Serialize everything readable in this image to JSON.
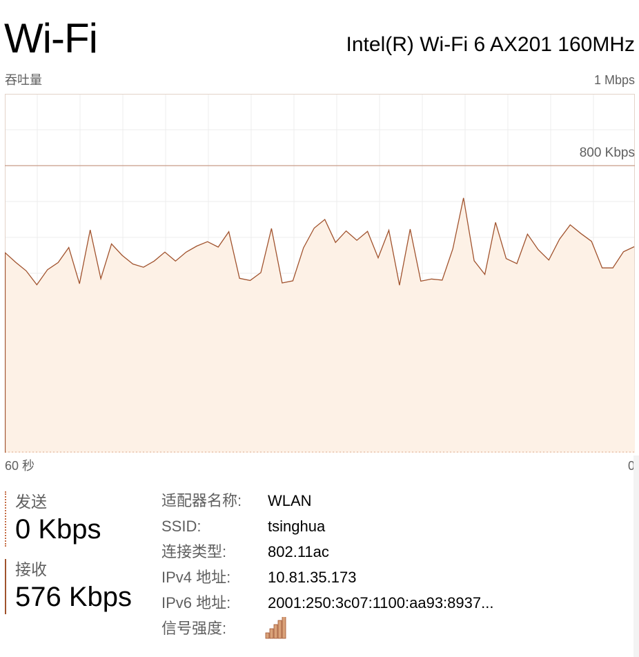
{
  "header": {
    "title": "Wi-Fi",
    "adapter_name": "Intel(R) Wi-Fi 6 AX201 160MHz"
  },
  "graph": {
    "throughput_label": "吞吐量",
    "max_label": "1 Mbps",
    "reference_label": "800 Kbps",
    "time_left_label": "60 秒",
    "time_right_label": "0",
    "colors": {
      "line": "#a0522d",
      "fill": "#fdf1e6",
      "grid": "#ececec",
      "reference_line": "#c89b87",
      "border": "#e3d3c9",
      "dashed_send": "#c46a42"
    }
  },
  "chart_data": {
    "type": "area",
    "title": "吞吐量",
    "ylim": [
      0,
      1000
    ],
    "reference_kbps": 800,
    "series": [
      {
        "name": "接收",
        "values": [
          558,
          531,
          507,
          468,
          510,
          530,
          572,
          471,
          621,
          485,
          582,
          550,
          526,
          517,
          534,
          559,
          534,
          559,
          576,
          588,
          573,
          616,
          486,
          480,
          502,
          625,
          473,
          479,
          571,
          626,
          650,
          586,
          618,
          592,
          617,
          543,
          620,
          467,
          623,
          478,
          484,
          481,
          568,
          710,
          535,
          497,
          642,
          541,
          527,
          609,
          566,
          537,
          595,
          635,
          611,
          589,
          515,
          515,
          560,
          574
        ]
      },
      {
        "name": "发送",
        "values": [
          0,
          0,
          0,
          0,
          0,
          0,
          0,
          0,
          0,
          0,
          0,
          0,
          0,
          0,
          0,
          0,
          0,
          0,
          0,
          0,
          0,
          0,
          0,
          0,
          0,
          0,
          0,
          0,
          0,
          0,
          0,
          0,
          0,
          0,
          0,
          0,
          0,
          0,
          0,
          0,
          0,
          0,
          0,
          0,
          0,
          0,
          0,
          0,
          0,
          0,
          0,
          0,
          0,
          0,
          0,
          0,
          0,
          0,
          0,
          0
        ]
      }
    ]
  },
  "stats": {
    "send_label": "发送",
    "send_value": "0 Kbps",
    "recv_label": "接收",
    "recv_value": "576 Kbps"
  },
  "info": {
    "adapter_key": "适配器名称:",
    "adapter_value": "WLAN",
    "ssid_key": "SSID:",
    "ssid_value": "tsinghua",
    "conn_key": "连接类型:",
    "conn_value": "802.11ac",
    "ipv4_key": "IPv4 地址:",
    "ipv4_value": "10.81.35.173",
    "ipv6_key": "IPv6 地址:",
    "ipv6_value": "2001:250:3c07:1100:aa93:8937...",
    "signal_key": "信号强度:",
    "signal_icon": "signal-strength-icon",
    "signal_bars": 5,
    "signal_max_bars": 5
  }
}
